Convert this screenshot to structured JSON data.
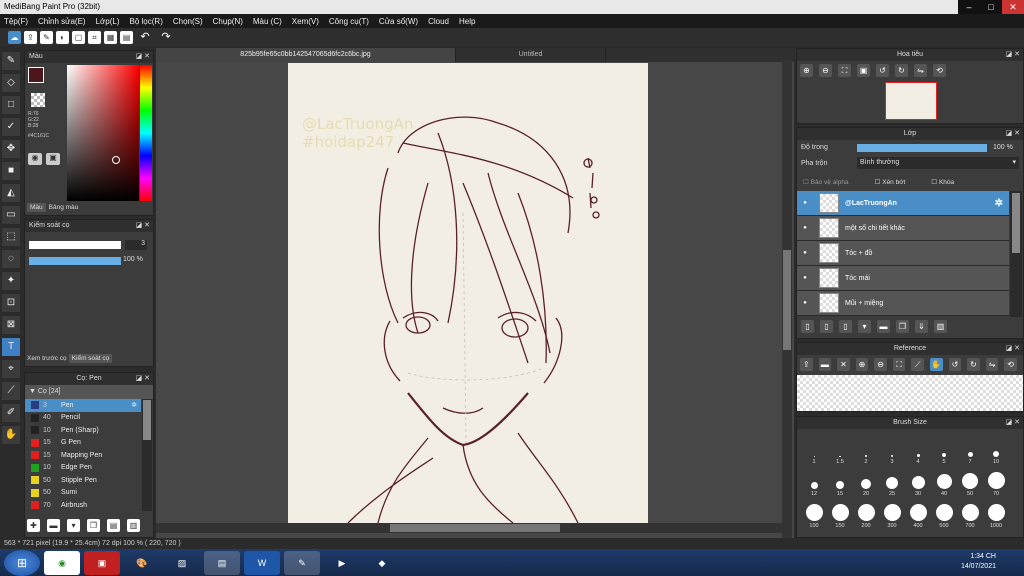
{
  "window": {
    "title": "MediBang Paint Pro (32bit)"
  },
  "menu": [
    "Tệp(F)",
    "Chỉnh sửa(E)",
    "Lớp(L)",
    "Bộ lọc(R)",
    "Chọn(S)",
    "Chụp(N)",
    "Màu (C)",
    "Xem(V)",
    "Công cụ(T)",
    "Cửa sổ(W)",
    "Cloud",
    "Help"
  ],
  "tabs": {
    "file": "825b95fe65c0bb142547065d6fc2c6bc.jpg",
    "untitled": "Untitled"
  },
  "color_panel": {
    "title": "Màu",
    "r": "R:76",
    "g": "G:22",
    "b": "B:28",
    "hex": "#4C161C",
    "tab_color": "Màu",
    "tab_palette": "Bảng màu",
    "primary": "#4C161C",
    "secondary": "#e8a496"
  },
  "brush_control": {
    "title": "Kiểm soát cọ",
    "size": "3",
    "opacity": "100 %",
    "tab_preview": "Xem trước cọ",
    "tab_control": "Kiểm soát cọ"
  },
  "brush_panel": {
    "title": "Cọ: Pen",
    "group": "Cọ [24]",
    "items": [
      {
        "size": "3",
        "name": "Pen",
        "color": "#2a3a80"
      },
      {
        "size": "40",
        "name": "Pencil",
        "color": "#222"
      },
      {
        "size": "10",
        "name": "Pen (Sharp)",
        "color": "#222"
      },
      {
        "size": "15",
        "name": "G Pen",
        "color": "#e02020"
      },
      {
        "size": "15",
        "name": "Mapping Pen",
        "color": "#e02020"
      },
      {
        "size": "10",
        "name": "Edge Pen",
        "color": "#20a020"
      },
      {
        "size": "50",
        "name": "Stipple Pen",
        "color": "#e8d020"
      },
      {
        "size": "50",
        "name": "Sumi",
        "color": "#e8d020"
      },
      {
        "size": "70",
        "name": "Airbrush",
        "color": "#e02020"
      }
    ]
  },
  "navigator": {
    "title": "Hoa tiêu"
  },
  "layer_panel": {
    "title": "Lớp",
    "opacity_label": "Độ trong",
    "opacity_value": "100 %",
    "blend_label": "Pha trộn",
    "blend_value": "Bình thường",
    "protect_alpha": "Bảo vệ alpha",
    "clipping": "Xén bớt",
    "lock": "Khóa",
    "layers": [
      "@LacTruongAn",
      "một số chi tiết khác",
      "Tóc + đồ",
      "Tóc mái",
      "Mũi + miệng"
    ]
  },
  "reference": {
    "title": "Reference"
  },
  "brush_size": {
    "title": "Brush Size",
    "sizes": [
      "1",
      "1.5",
      "2",
      "3",
      "4",
      "5",
      "7",
      "10",
      "12",
      "15",
      "20",
      "25",
      "30",
      "40",
      "50",
      "70",
      "100",
      "150",
      "200",
      "300",
      "400",
      "500",
      "700",
      "1000"
    ]
  },
  "canvas_text": {
    "wm1": "@LacTruongAn",
    "wm2": "#hoidap247"
  },
  "status": "563 * 721 pixel  (19.9 * 25.4cm)  72 dpi  100 %  ( 220, 720 )",
  "clock": {
    "time": "1:34 CH",
    "date": "14/07/2021"
  }
}
